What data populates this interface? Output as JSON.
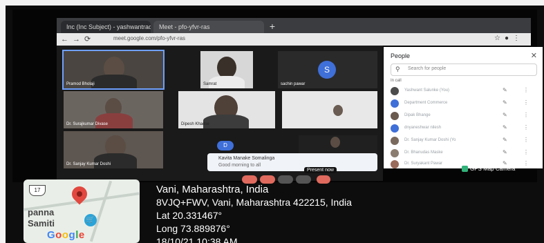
{
  "browser": {
    "tabs": [
      {
        "label": "Inc (Inc Subject) - yashwantrao (Mail)",
        "active": false
      },
      {
        "label": "Meet - pfo-yfvr-ras",
        "active": true
      }
    ],
    "url": "meet.google.com/pfo-yfvr-ras"
  },
  "meeting": {
    "tiles": [
      {
        "name": "Pramod Bholaji",
        "active": true
      },
      {
        "name": "Samrat",
        "active": false
      },
      {
        "name": "sachin pawar",
        "initial": "S",
        "active": false
      },
      {
        "name": "Dr. Surajkumar Divase",
        "active": false
      },
      {
        "name": "Dipesh Khadse",
        "active": false
      },
      {
        "name": "",
        "active": false
      },
      {
        "name": "Dr. Sanjay Kumar Doshi",
        "active": false
      },
      {
        "name": "",
        "initial": "D",
        "active": false
      },
      {
        "name": "",
        "active": false
      }
    ],
    "chat": {
      "sender": "Kavita Manake Somalinga",
      "message": "Good morning to all"
    },
    "present_label": "Present now"
  },
  "people_panel": {
    "title": "People",
    "search_placeholder": "Search for people",
    "section": "In call",
    "participants": [
      "Yashwant Salunke (You)",
      "Department Commerce",
      "Dipak Bhange",
      "dnyaneshwar nilesh",
      "Dr. Sanjay Kumar Doshi (Yo",
      "Dr. Bhanudas Maske",
      "Dr. Suryakant Pawar"
    ]
  },
  "gps": {
    "badge": "GPS Map Camera",
    "place": "Vani, Maharashtra, India",
    "address": "8VJQ+FWV, Vani, Maharashtra 422215, India",
    "lat": "Lat 20.331467°",
    "long": "Long 73.889876°",
    "datetime": "18/10/21 10:38 AM"
  },
  "map": {
    "route_shield": "17",
    "label_line1": "panna",
    "label_line2": "Samiti",
    "brand": "Google"
  }
}
